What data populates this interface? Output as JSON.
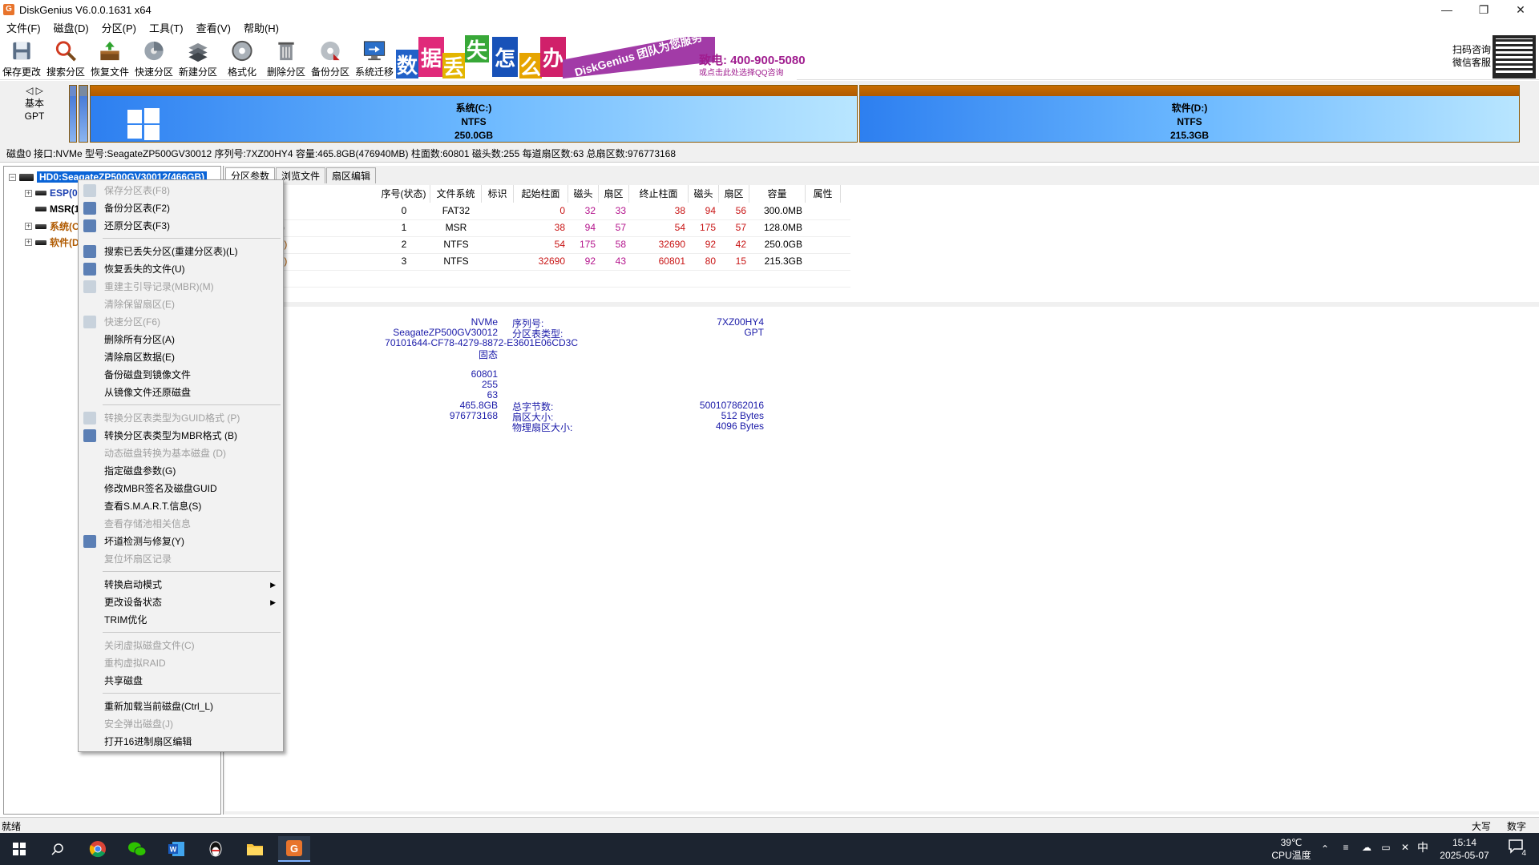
{
  "window": {
    "title": "DiskGenius V6.0.0.1631 x64",
    "app_icon": "G"
  },
  "menu": [
    "文件(F)",
    "磁盘(D)",
    "分区(P)",
    "工具(T)",
    "查看(V)",
    "帮助(H)"
  ],
  "toolbar": [
    {
      "label": "保存更改",
      "icon": "save-icon"
    },
    {
      "label": "搜索分区",
      "icon": "search-icon"
    },
    {
      "label": "恢复文件",
      "icon": "restore-file-icon"
    },
    {
      "label": "快速分区",
      "icon": "quick-partition-icon"
    },
    {
      "label": "新建分区",
      "icon": "new-partition-icon"
    },
    {
      "label": "格式化",
      "icon": "format-icon"
    },
    {
      "label": "删除分区",
      "icon": "delete-icon"
    },
    {
      "label": "备份分区",
      "icon": "backup-icon"
    },
    {
      "label": "系统迁移",
      "icon": "migrate-icon"
    }
  ],
  "banner": {
    "chars": [
      "数",
      "据",
      "丢",
      "失",
      "怎",
      "么",
      "办"
    ],
    "slogan": "DiskGenius 团队为您服务",
    "phone": "致电: 400-900-5080",
    "qq": "或点击此处选择QQ咨询",
    "qr_label_1": "扫码咨询",
    "qr_label_2": "微信客服"
  },
  "diskmap": {
    "nav_line1": "基本",
    "nav_line2": "GPT",
    "partitions": [
      {
        "name": "系统(C:)",
        "fs": "NTFS",
        "size": "250.0GB"
      },
      {
        "name": "软件(D:)",
        "fs": "NTFS",
        "size": "215.3GB"
      }
    ]
  },
  "diskinfo": "磁盘0 接口:NVMe  型号:SeagateZP500GV30012  序列号:7XZ00HY4  容量:465.8GB(476940MB)  柱面数:60801  磁头数:255  每道扇区数:63  总扇区数:976773168",
  "tree": {
    "root": "HD0:SeagateZP500GV30012(466GB)",
    "items": [
      "ESP(0:)",
      "MSR(1)",
      "系统(C:)",
      "软件(D:)"
    ]
  },
  "tabs": [
    "分区参数",
    "浏览文件",
    "扇区编辑"
  ],
  "partition_table": {
    "headers": [
      "序号(状态)",
      "文件系统",
      "标识",
      "起始柱面",
      "磁头",
      "扇区",
      "终止柱面",
      "磁头",
      "扇区",
      "容量",
      "属性"
    ],
    "rows": [
      {
        "name_tail": "",
        "idx": "0",
        "fs": "FAT32",
        "sc": "0",
        "sh": "32",
        "ss": "33",
        "ec": "38",
        "eh": "94",
        "es": "56",
        "cap": "300.0MB"
      },
      {
        "name_tail": ")",
        "idx": "1",
        "fs": "MSR",
        "sc": "38",
        "sh": "94",
        "ss": "57",
        "ec": "54",
        "eh": "175",
        "es": "57",
        "cap": "128.0MB"
      },
      {
        "name_tail": ":)",
        "idx": "2",
        "fs": "NTFS",
        "sc": "54",
        "sh": "175",
        "ss": "58",
        "ec": "32690",
        "eh": "92",
        "es": "42",
        "cap": "250.0GB"
      },
      {
        "name_tail": ":)",
        "idx": "3",
        "fs": "NTFS",
        "sc": "32690",
        "sh": "92",
        "ss": "43",
        "ec": "60801",
        "eh": "80",
        "es": "15",
        "cap": "215.3GB"
      }
    ]
  },
  "details": {
    "interface": "NVMe",
    "model": "SeagateZP500GV30012",
    "guid": "70101644-CF78-4279-8872-E3601E06CD3C",
    "type": "固态",
    "serial_label": "序列号:",
    "serial": "7XZ00HY4",
    "pt_label": "分区表类型:",
    "pt": "GPT",
    "cylinders": "60801",
    "heads": "255",
    "sectors": "63",
    "capacity": "465.8GB",
    "total_sectors": "976773168",
    "total_bytes_label": "总字节数:",
    "total_bytes": "500107862016",
    "sector_size_label": "扇区大小:",
    "sector_size": "512 Bytes",
    "phys_sector_label": "物理扇区大小:",
    "phys_sector": "4096 Bytes"
  },
  "context_menu": [
    {
      "label": "保存分区表(F8)",
      "disabled": true,
      "icon": "save-icon"
    },
    {
      "label": "备份分区表(F2)",
      "disabled": false,
      "icon": "backup-table-icon"
    },
    {
      "label": "还原分区表(F3)",
      "disabled": false,
      "icon": "restore-table-icon"
    },
    {
      "sep": true
    },
    {
      "label": "搜索已丢失分区(重建分区表)(L)",
      "disabled": false,
      "icon": "search-icon"
    },
    {
      "label": "恢复丢失的文件(U)",
      "disabled": false,
      "icon": "restore-file-icon"
    },
    {
      "label": "重建主引导记录(MBR)(M)",
      "disabled": true,
      "icon": "mbr-icon"
    },
    {
      "label": "清除保留扇区(E)",
      "disabled": true
    },
    {
      "label": "快速分区(F6)",
      "disabled": true,
      "icon": "quick-partition-icon"
    },
    {
      "label": "删除所有分区(A)",
      "disabled": false
    },
    {
      "label": "清除扇区数据(E)",
      "disabled": false
    },
    {
      "label": "备份磁盘到镜像文件",
      "disabled": false
    },
    {
      "label": "从镜像文件还原磁盘",
      "disabled": false
    },
    {
      "sep": true
    },
    {
      "label": "转换分区表类型为GUID格式 (P)",
      "disabled": true,
      "icon": "convert-icon"
    },
    {
      "label": "转换分区表类型为MBR格式 (B)",
      "disabled": false,
      "icon": "convert-mbr-icon"
    },
    {
      "label": "动态磁盘转换为基本磁盘 (D)",
      "disabled": true
    },
    {
      "label": "指定磁盘参数(G)",
      "disabled": false
    },
    {
      "label": "修改MBR签名及磁盘GUID",
      "disabled": false
    },
    {
      "label": "查看S.M.A.R.T.信息(S)",
      "disabled": false
    },
    {
      "label": "查看存储池相关信息",
      "disabled": true
    },
    {
      "label": "坏道检测与修复(Y)",
      "disabled": false,
      "icon": "repair-icon"
    },
    {
      "label": "复位坏扇区记录",
      "disabled": true
    },
    {
      "sep": true
    },
    {
      "label": "转换启动模式",
      "disabled": false,
      "submenu": true
    },
    {
      "label": "更改设备状态",
      "disabled": false,
      "submenu": true
    },
    {
      "label": "TRIM优化",
      "disabled": false
    },
    {
      "sep": true
    },
    {
      "label": "关闭虚拟磁盘文件(C)",
      "disabled": true
    },
    {
      "label": "重构虚拟RAID",
      "disabled": true
    },
    {
      "label": "共享磁盘",
      "disabled": false
    },
    {
      "sep": true
    },
    {
      "label": "重新加载当前磁盘(Ctrl_L)",
      "disabled": false
    },
    {
      "label": "安全弹出磁盘(J)",
      "disabled": true
    },
    {
      "label": "打开16进制扇区编辑",
      "disabled": false
    }
  ],
  "status": {
    "left": "就绪",
    "caps": "大写",
    "num": "数字"
  },
  "taskbar": {
    "temp": "39℃",
    "temp_label": "CPU温度",
    "ime": "中",
    "time": "15:14",
    "date": "2025-05-07",
    "notif_count": "4"
  }
}
